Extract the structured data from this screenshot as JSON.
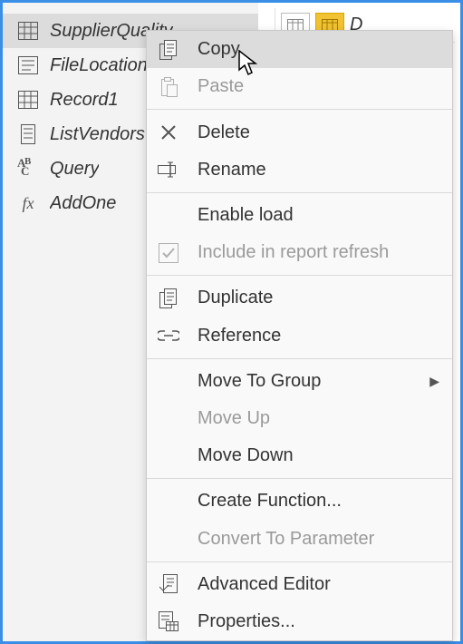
{
  "queries": {
    "items": [
      {
        "label": "SupplierQuality",
        "icon": "table-icon",
        "selected": true
      },
      {
        "label": "FileLocation",
        "icon": "parameter-icon",
        "selected": false
      },
      {
        "label": "Record1",
        "icon": "table-icon",
        "selected": false
      },
      {
        "label": "ListVendors",
        "icon": "list-icon",
        "selected": false
      },
      {
        "label": "Query",
        "icon": "abc-icon",
        "selected": false
      },
      {
        "label": "AddOne",
        "icon": "fx-icon",
        "selected": false
      }
    ]
  },
  "top_right": {
    "partial_label": "D"
  },
  "context_menu": {
    "items": [
      {
        "label": "Copy",
        "icon": "copy-icon",
        "disabled": false,
        "hover": true,
        "submenu": false
      },
      {
        "label": "Paste",
        "icon": "paste-icon",
        "disabled": true,
        "hover": false,
        "submenu": false
      },
      {
        "sep": true
      },
      {
        "label": "Delete",
        "icon": "delete-x-icon",
        "disabled": false,
        "hover": false,
        "submenu": false
      },
      {
        "label": "Rename",
        "icon": "rename-icon",
        "disabled": false,
        "hover": false,
        "submenu": false
      },
      {
        "sep": true
      },
      {
        "label": "Enable load",
        "icon": "",
        "disabled": false,
        "hover": false,
        "submenu": false
      },
      {
        "label": "Include in report refresh",
        "icon": "check-icon",
        "disabled": true,
        "hover": false,
        "submenu": false
      },
      {
        "sep": true
      },
      {
        "label": "Duplicate",
        "icon": "copy-icon",
        "disabled": false,
        "hover": false,
        "submenu": false
      },
      {
        "label": "Reference",
        "icon": "link-icon",
        "disabled": false,
        "hover": false,
        "submenu": false
      },
      {
        "sep": true
      },
      {
        "label": "Move To Group",
        "icon": "",
        "disabled": false,
        "hover": false,
        "submenu": true
      },
      {
        "label": "Move Up",
        "icon": "",
        "disabled": true,
        "hover": false,
        "submenu": false
      },
      {
        "label": "Move Down",
        "icon": "",
        "disabled": false,
        "hover": false,
        "submenu": false
      },
      {
        "sep": true
      },
      {
        "label": "Create Function...",
        "icon": "",
        "disabled": false,
        "hover": false,
        "submenu": false
      },
      {
        "label": "Convert To Parameter",
        "icon": "",
        "disabled": true,
        "hover": false,
        "submenu": false
      },
      {
        "sep": true
      },
      {
        "label": "Advanced Editor",
        "icon": "editor-icon",
        "disabled": false,
        "hover": false,
        "submenu": false
      },
      {
        "label": "Properties...",
        "icon": "properties-icon",
        "disabled": false,
        "hover": false,
        "submenu": false
      }
    ]
  }
}
